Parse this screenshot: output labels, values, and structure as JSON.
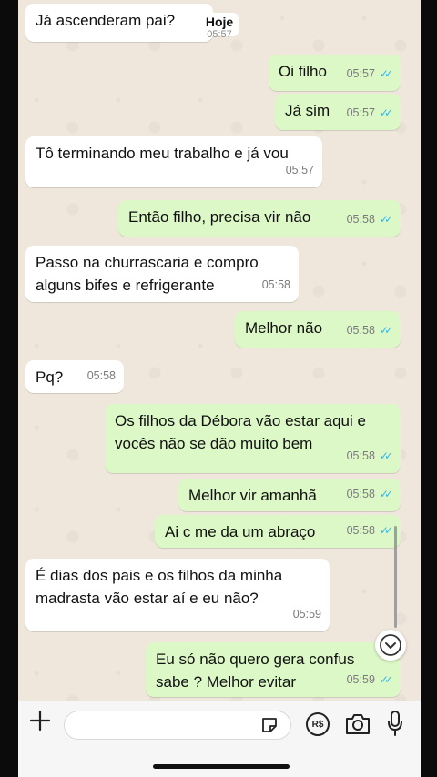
{
  "date_chip": "Hoje",
  "messages": [
    {
      "dir": "in",
      "lines": [
        "Já ascenderam pai?"
      ],
      "time": "05:57",
      "ticks": ""
    },
    {
      "dir": "out",
      "lines": [
        "Oi filho"
      ],
      "time": "05:57",
      "ticks": "✓✓"
    },
    {
      "dir": "out",
      "lines": [
        "Já sim"
      ],
      "time": "05:57",
      "ticks": "✓✓"
    },
    {
      "dir": "in",
      "lines": [
        "Tô terminando meu trabalho e já vou"
      ],
      "time": "05:57",
      "ticks": ""
    },
    {
      "dir": "out",
      "lines": [
        "Então filho, precisa vir não"
      ],
      "time": "05:58",
      "ticks": "✓✓"
    },
    {
      "dir": "in",
      "lines": [
        "Passo na churrascaria e compro",
        "alguns bifes e refrigerante"
      ],
      "time": "05:58",
      "ticks": ""
    },
    {
      "dir": "out",
      "lines": [
        "Melhor não"
      ],
      "time": "05:58",
      "ticks": "✓✓"
    },
    {
      "dir": "in",
      "lines": [
        "Pq?"
      ],
      "time": "05:58",
      "ticks": ""
    },
    {
      "dir": "out",
      "lines": [
        "Os filhos da Débora vão estar aqui e",
        "vocês não se dão muito bem"
      ],
      "time": "05:58",
      "ticks": "✓✓"
    },
    {
      "dir": "out",
      "lines": [
        "Melhor vir amanhã"
      ],
      "time": "05:58",
      "ticks": "✓✓"
    },
    {
      "dir": "out",
      "lines": [
        "Ai c me da um abraço"
      ],
      "time": "05:58",
      "ticks": "✓✓"
    },
    {
      "dir": "in",
      "lines": [
        "É dias dos pais e os filhos da minha",
        "madrasta vão estar aí e eu não?"
      ],
      "time": "05:59",
      "ticks": ""
    },
    {
      "dir": "out",
      "lines": [
        "Eu só não quero gera confus",
        "sabe ? Melhor evitar"
      ],
      "time": "05:59",
      "ticks": "✓✓"
    }
  ],
  "composer": {
    "plus_icon": "plus-icon",
    "sticker_icon": "sticker-icon",
    "payment_icon": "payment-rs-icon",
    "payment_label": "R$",
    "camera_icon": "camera-icon",
    "mic_icon": "microphone-icon"
  },
  "colors": {
    "incoming": "#ffffff",
    "outgoing": "#dcf8c6",
    "read_ticks": "#34b7f1",
    "wallpaper": "#efe7dc"
  }
}
